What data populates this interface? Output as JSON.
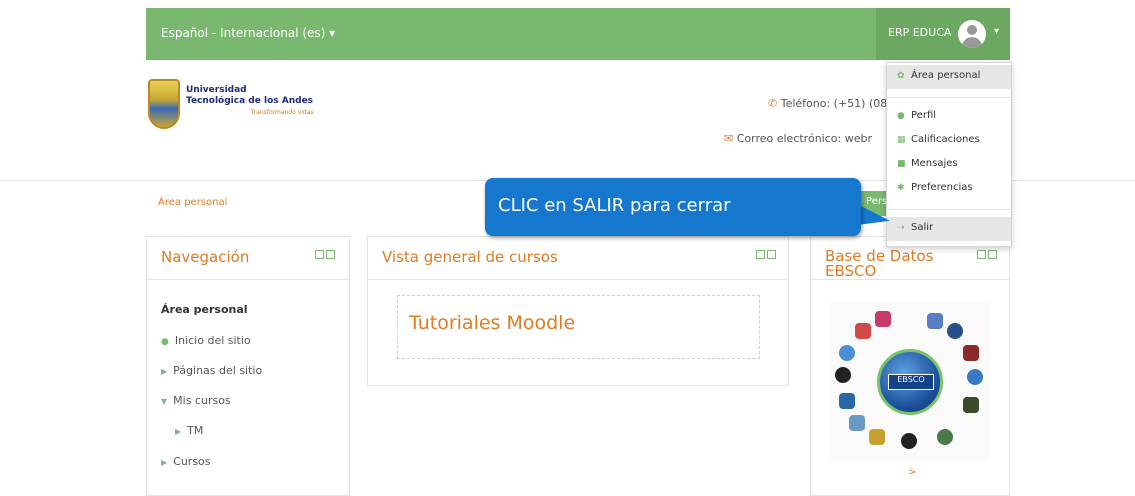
{
  "header": {
    "language_selector": "Español - Internacional (es) ▾",
    "user_name": "ERP EDUCA",
    "user_caret": "▾"
  },
  "logo": {
    "line1": "Universidad",
    "line2": "Tecnológica de los Andes",
    "slogan": "Transformando vidas"
  },
  "contact": {
    "phone_icon": "phone-icon",
    "phone": "Teléfono: (+51) (08",
    "email_icon": "envelope-icon",
    "email": "Correo electrónico: webr"
  },
  "breadcrumb": "Área personal",
  "customize_button": "Pers",
  "callout": "CLIC en SALIR para cerrar",
  "user_menu": {
    "items": [
      {
        "label": "Área personal",
        "icon": "dashboard-icon"
      },
      {
        "label": "Perfil",
        "icon": "user-icon"
      },
      {
        "label": "Calificaciones",
        "icon": "grades-icon"
      },
      {
        "label": "Mensajes",
        "icon": "message-icon"
      },
      {
        "label": "Preferencias",
        "icon": "wrench-icon"
      },
      {
        "label": "Salir",
        "icon": "logout-icon"
      }
    ]
  },
  "navigation": {
    "title": "Navegación",
    "items": [
      {
        "label": "Área personal"
      },
      {
        "label": "Inicio del sitio"
      },
      {
        "label": "Páginas del sitio"
      },
      {
        "label": "Mis cursos"
      },
      {
        "label": "TM"
      },
      {
        "label": "Cursos"
      }
    ]
  },
  "course_overview": {
    "title": "Vista general de cursos",
    "course": "Tutoriales Moodle"
  },
  "ebsco_block": {
    "title_line1": "Base de Datos",
    "title_line2": "EBSCO",
    "logo_text": "EBSCO",
    "more": ">"
  },
  "colors": {
    "accent_green": "#7ab870",
    "accent_orange": "#e07b22",
    "callout_blue": "#1677cf"
  }
}
